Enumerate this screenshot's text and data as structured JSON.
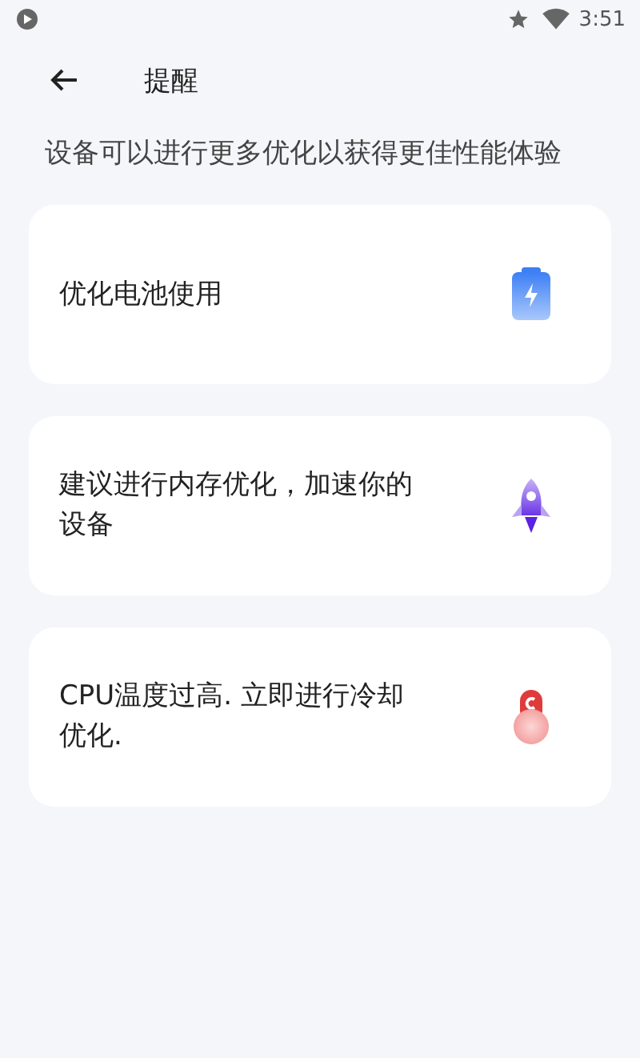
{
  "status_bar": {
    "time": "3:51"
  },
  "header": {
    "title": "提醒"
  },
  "subtitle": "设备可以进行更多优化以获得更佳性能体验",
  "cards": [
    {
      "text": "优化电池使用",
      "kind": "battery"
    },
    {
      "text": "建议进行内存优化，加速你的设备",
      "kind": "rocket"
    },
    {
      "text": "CPU温度过高. 立即进行冷却优化.",
      "kind": "thermometer"
    }
  ]
}
